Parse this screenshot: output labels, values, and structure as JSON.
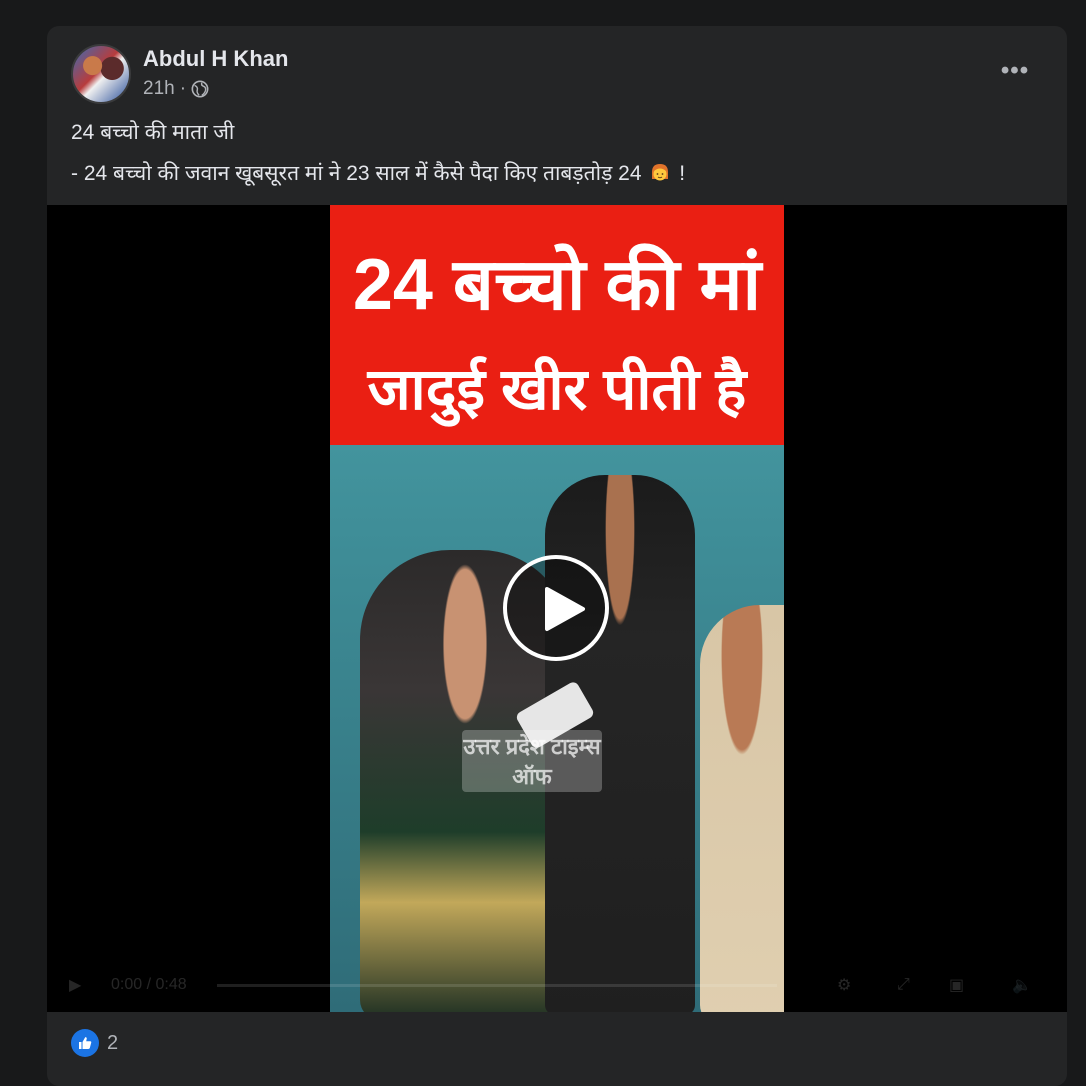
{
  "post": {
    "author": "Abdul H Khan",
    "time": "21h",
    "separator": "·",
    "privacy_icon": "globe-icon",
    "more_label": "•••",
    "text_line1": "24 बच्चो की माता जी",
    "text_line2_a": " - 24 बच्चो की जवान खूबसूरत मां ने 23 साल में कैसे पैदा किए ताबड़तोड़ 24",
    "text_line2_b": "!"
  },
  "video": {
    "banner_line1": "24 बच्चो की मां",
    "banner_line2": "जादुई खीर पीती है",
    "watermark": "उत्तर प्रदेश टाइम्स ऑफ",
    "banner_color": "#ea1f13",
    "controls": {
      "time": "0:00 / 0:48"
    }
  },
  "reactions": {
    "like_count": "2",
    "accent": "#1b74e4"
  }
}
